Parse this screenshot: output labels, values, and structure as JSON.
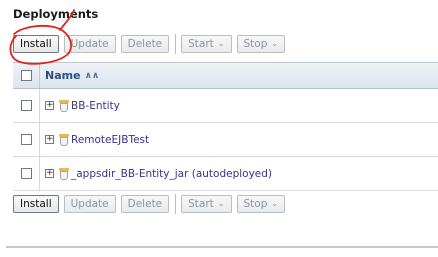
{
  "section_title": "Deployments",
  "toolbar": {
    "install": "Install",
    "update": "Update",
    "delete": "Delete",
    "start": "Start",
    "stop": "Stop"
  },
  "table": {
    "name_header": "Name",
    "rows": [
      {
        "name": "BB-Entity"
      },
      {
        "name": "RemoteEJBTest"
      },
      {
        "name": "_appsdir_BB-Entity_jar (autodeployed)"
      }
    ]
  },
  "icons": {
    "expand": "plus-box-icon",
    "deployment": "jar-icon",
    "sort": "sort-ascending-icon",
    "menu": "chevron-down-icon"
  },
  "colors": {
    "header_text": "#2a4f86",
    "link": "#3a3388",
    "annotation": "#e0241b"
  }
}
